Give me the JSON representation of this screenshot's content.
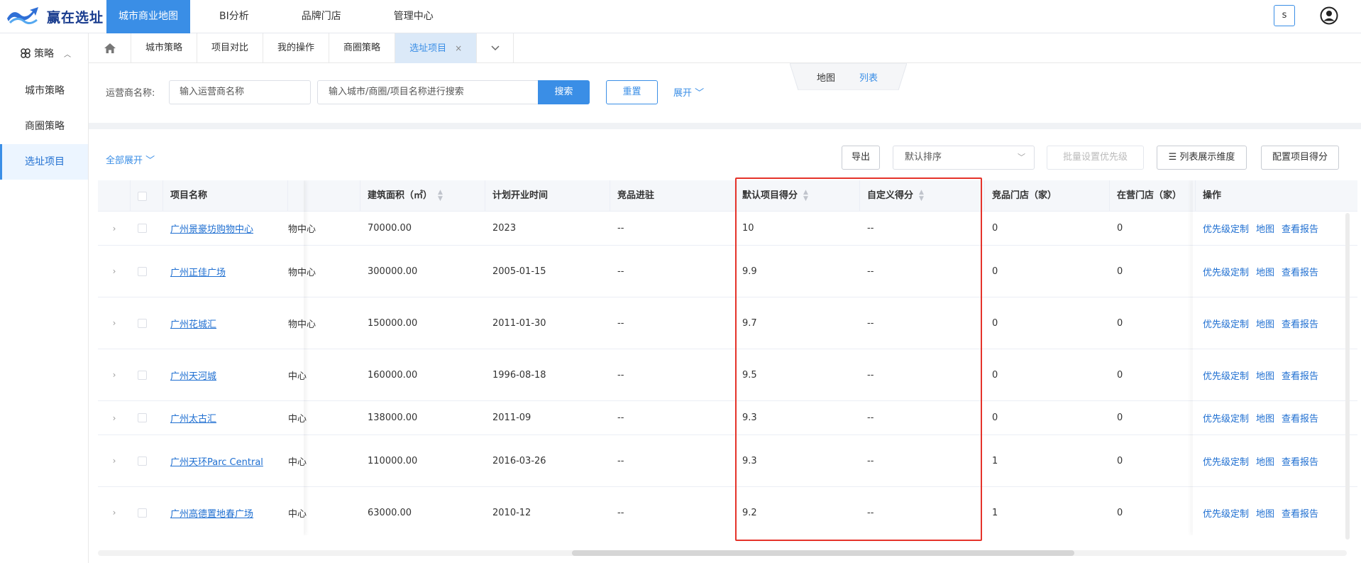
{
  "app": {
    "logo_text": "赢在选址",
    "nav": [
      {
        "label": "城市商业地图",
        "active": true
      },
      {
        "label": "BI分析",
        "active": false
      },
      {
        "label": "品牌门店",
        "active": false
      },
      {
        "label": "管理中心",
        "active": false
      }
    ],
    "user_initial": "s"
  },
  "sidebar": {
    "group_label": "策略",
    "items": [
      {
        "label": "城市策略",
        "active": false
      },
      {
        "label": "商圈策略",
        "active": false
      },
      {
        "label": "选址项目",
        "active": true
      }
    ]
  },
  "tabs": [
    {
      "label": "城市策略",
      "active": false
    },
    {
      "label": "项目对比",
      "active": false
    },
    {
      "label": "我的操作",
      "active": false
    },
    {
      "label": "商圈策略",
      "active": false
    },
    {
      "label": "选址项目",
      "active": true,
      "close": "×"
    }
  ],
  "filter": {
    "view_map": "地图",
    "view_list": "列表",
    "operator_label": "运营商名称:",
    "operator_placeholder": "输入运营商名称",
    "search_placeholder": "输入城市/商圈/项目名称进行搜索",
    "search_btn": "搜索",
    "reset_btn": "重置",
    "expand": "展开"
  },
  "toolbar": {
    "expand_all": "全部展开",
    "export": "导出",
    "sort_value": "默认排序",
    "batch_priority": "批量设置优先级",
    "list_dims": "列表展示维度",
    "config_score": "配置项目得分"
  },
  "table": {
    "headers": {
      "name": "项目名称",
      "area": "建筑面积（㎡）",
      "open_time": "计划开业时间",
      "competitor": "竞品进驻",
      "default_score": "默认项目得分",
      "custom_score": "自定义得分",
      "competitor_stores": "竞品门店（家）",
      "open_stores": "在营门店（家）",
      "ops": "操作"
    },
    "op_labels": {
      "priority": "优先级定制",
      "map": "地图",
      "report": "查看报告"
    },
    "rows": [
      {
        "name": "广州景豪坊购物中心",
        "type_tail": "物中心",
        "area": "70000.00",
        "open_time": "2023",
        "competitor": "--",
        "default_score": "10",
        "custom_score": "--",
        "competitor_stores": "0",
        "open_stores": "0"
      },
      {
        "name": "广州正佳广场",
        "type_tail": "物中心",
        "area": "300000.00",
        "open_time": "2005-01-15",
        "competitor": "--",
        "default_score": "9.9",
        "custom_score": "--",
        "competitor_stores": "0",
        "open_stores": "0"
      },
      {
        "name": "广州花城汇",
        "type_tail": "物中心",
        "area": "150000.00",
        "open_time": "2011-01-30",
        "competitor": "--",
        "default_score": "9.7",
        "custom_score": "--",
        "competitor_stores": "0",
        "open_stores": "0"
      },
      {
        "name": "广州天河城",
        "type_tail": "中心",
        "area": "160000.00",
        "open_time": "1996-08-18",
        "competitor": "--",
        "default_score": "9.5",
        "custom_score": "--",
        "competitor_stores": "0",
        "open_stores": "0"
      },
      {
        "name": "广州太古汇",
        "type_tail": "中心",
        "area": "138000.00",
        "open_time": "2011-09",
        "competitor": "--",
        "default_score": "9.3",
        "custom_score": "--",
        "competitor_stores": "0",
        "open_stores": "0"
      },
      {
        "name": "广州天环Parc Central",
        "type_tail": "中心",
        "area": "110000.00",
        "open_time": "2016-03-26",
        "competitor": "--",
        "default_score": "9.3",
        "custom_score": "--",
        "competitor_stores": "1",
        "open_stores": "0"
      },
      {
        "name": "广州高德置地春广场",
        "type_tail": "中心",
        "area": "63000.00",
        "open_time": "2010-12",
        "competitor": "--",
        "default_score": "9.2",
        "custom_score": "--",
        "competitor_stores": "1",
        "open_stores": "0"
      }
    ]
  },
  "colors": {
    "primary": "#3a8ee6",
    "highlight": "#e5332a"
  }
}
